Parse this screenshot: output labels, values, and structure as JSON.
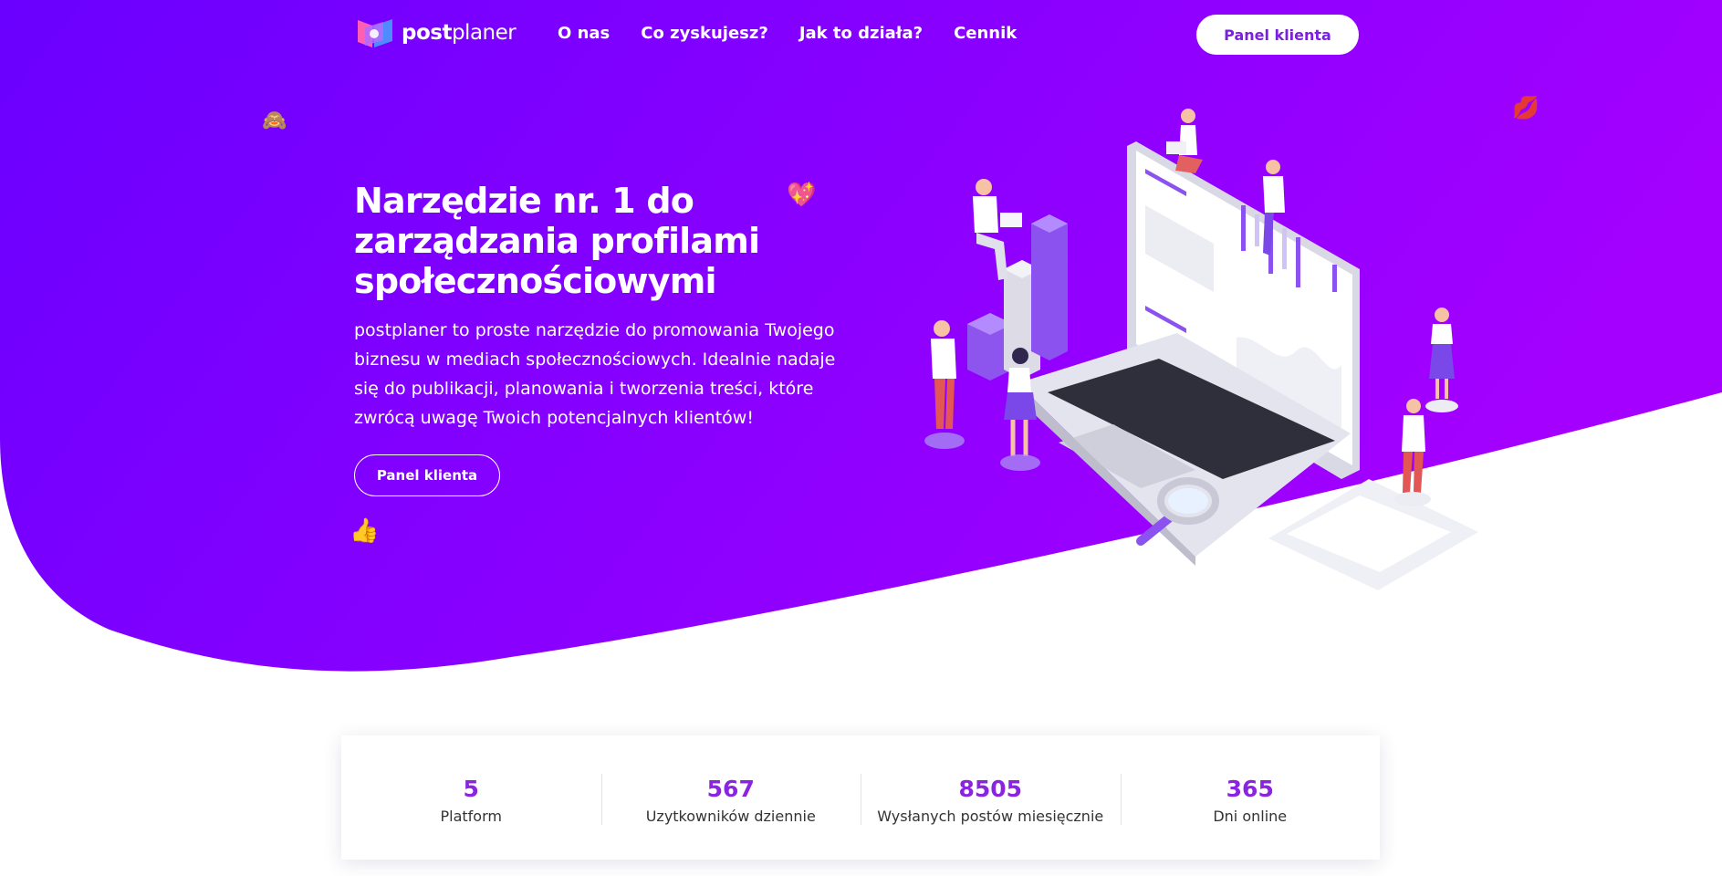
{
  "brand": {
    "name_bold": "post",
    "name_light": "planer"
  },
  "nav": {
    "links": [
      "O nas",
      "Co zyskujesz?",
      "Jak to działa?",
      "Cennik"
    ],
    "cta": "Panel klienta"
  },
  "hero": {
    "title": "Narzędzie nr. 1 do zarządzania profilami społecznościowymi",
    "text": "postplaner to proste narzędzie do promowania Twojego biznesu w mediach społecznościowych. Idealnie nadaje się do publikacji, planowania i tworzenia treści, które zwrócą uwagę Twoich potencjalnych klientów!",
    "cta": "Panel klienta"
  },
  "emojis": {
    "monkey": "🙈",
    "heart": "💖",
    "kiss": "💋",
    "thumbs": "👍"
  },
  "stats": [
    {
      "value": "5",
      "label": "Platform"
    },
    {
      "value": "567",
      "label": "Uzytkowników dziennie"
    },
    {
      "value": "8505",
      "label": "Wysłanych postów miesięcznie"
    },
    {
      "value": "365",
      "label": "Dni online"
    }
  ],
  "colors": {
    "hero_gradient_start": "#6a00ff",
    "hero_gradient_end": "#a400ff",
    "accent": "#8a24e0",
    "white": "#ffffff"
  }
}
